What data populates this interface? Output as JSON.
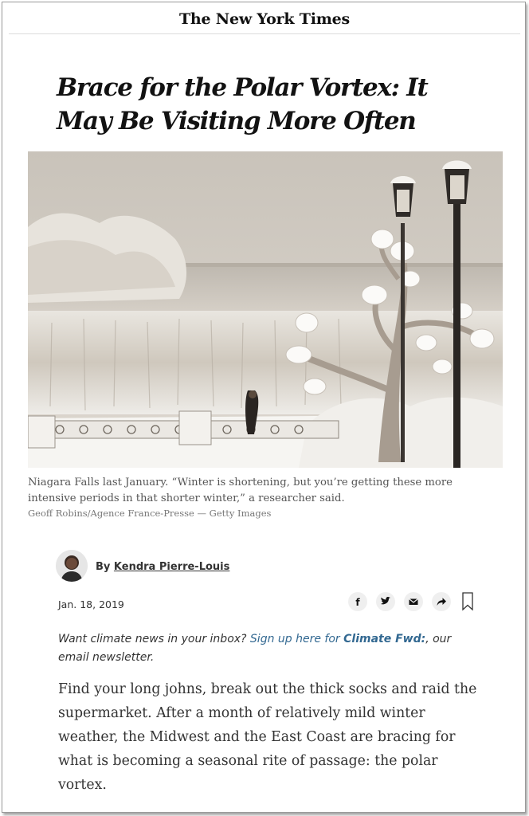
{
  "masthead": {
    "logo_text": "The New York Times"
  },
  "article": {
    "headline": "Brace for the Polar Vortex: It May Be Visiting More Often",
    "photo": {
      "subject": "snow-covered lampposts and tree at Niagara Falls"
    },
    "caption": "Niagara Falls last January. “Winter is shortening, but you’re getting these more intensive periods in that shorter winter,” a researcher said.",
    "credit": "Geoff Robins/Agence France-Presse — Getty Images",
    "byline": {
      "prefix": "By",
      "author": "Kendra Pierre-Louis"
    },
    "date": "Jan. 18, 2019",
    "share_icons": [
      "facebook-icon",
      "twitter-icon",
      "email-icon",
      "share-icon",
      "bookmark-icon"
    ],
    "promo": {
      "text_before": "Want climate news in your inbox? ",
      "link_text": "Sign up here for ",
      "link_strong": "Climate Fwd:",
      "text_after": ", our email newsletter."
    },
    "body": "Find your long johns, break out the thick socks and raid the supermarket. After a month of relatively mild winter weather, the Midwest and the East Coast are bracing for what is becoming a seasonal rite of passage: the polar vortex."
  },
  "colors": {
    "link": "#326891",
    "text": "#333333",
    "headline": "#121212"
  }
}
